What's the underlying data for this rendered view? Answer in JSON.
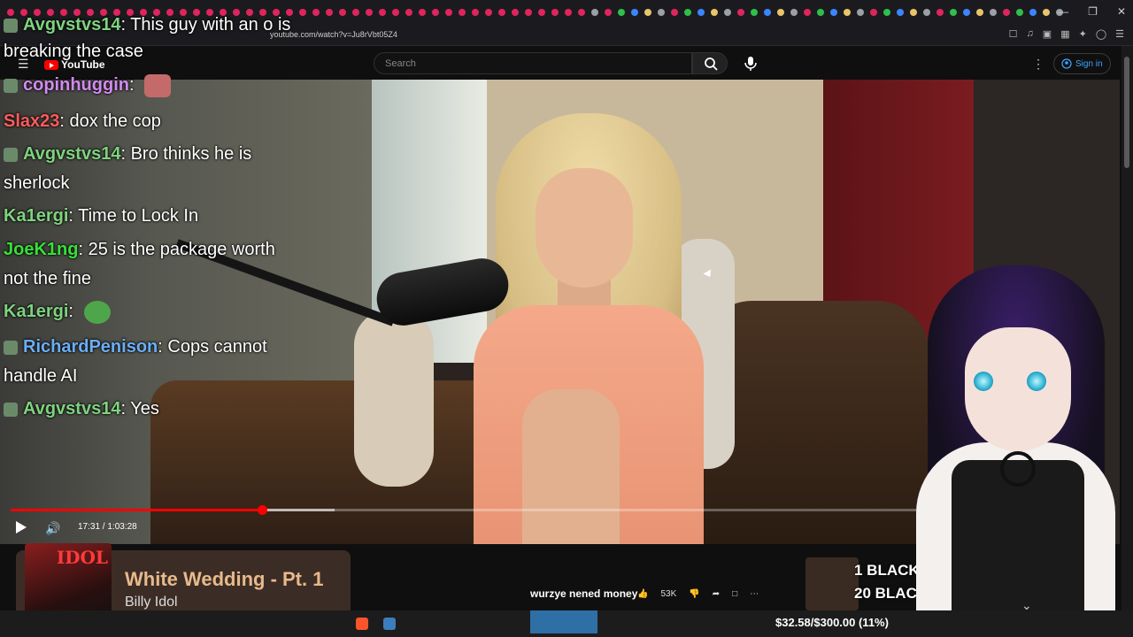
{
  "browser": {
    "url": "youtube.com/watch?v=Ju8rVbt05Z4"
  },
  "youtube": {
    "logo": "YouTube",
    "search_placeholder": "Search",
    "signin_label": "Sign in"
  },
  "chat": {
    "messages": [
      {
        "user": "Avgvstvs14",
        "user_color": "#7fd37f",
        "text": ": This guy with an o is",
        "text2": "breaking the case"
      },
      {
        "user": "copinhuggin",
        "user_color": "#d38af0",
        "text": ":"
      },
      {
        "user": "Slax23",
        "user_color": "#ff5c5c",
        "text": ": dox the cop"
      },
      {
        "user": "Avgvstvs14",
        "user_color": "#7fd37f",
        "text": ": Bro thinks he is",
        "text2": "sherlock"
      },
      {
        "user": "Ka1ergi",
        "user_color": "#7fd37f",
        "text": ": Time to Lock In"
      },
      {
        "user": "JoeK1ng",
        "user_color": "#38e038",
        "text": ": 25 is the package worth",
        "text2": "not the fine"
      },
      {
        "user": "Ka1ergi",
        "user_color": "#7fd37f",
        "text": ":"
      },
      {
        "user": "RichardPenison",
        "user_color": "#6aaef5",
        "text": ": Cops cannot",
        "text2": "handle AI"
      },
      {
        "user": "Avgvstvs14",
        "user_color": "#7fd37f",
        "text": ": Yes"
      }
    ]
  },
  "player": {
    "timecode": "17:31 / 1:03:28",
    "progress": 0.276,
    "buffered": 0.355
  },
  "now_playing": {
    "title": "White Wedding - Pt. 1",
    "artist": "Billy Idol",
    "art_text": "IDOL"
  },
  "video_info": {
    "below_text": "wurzye nened money",
    "like_count": "53K"
  },
  "thumbnail": {
    "line1": "1 BLACK C",
    "line2": "20 BLAC"
  },
  "donation": {
    "text": "$32.58/$300.00 (11%)"
  },
  "colors": {
    "accent": "#ff0000",
    "link": "#3ea6ff"
  }
}
